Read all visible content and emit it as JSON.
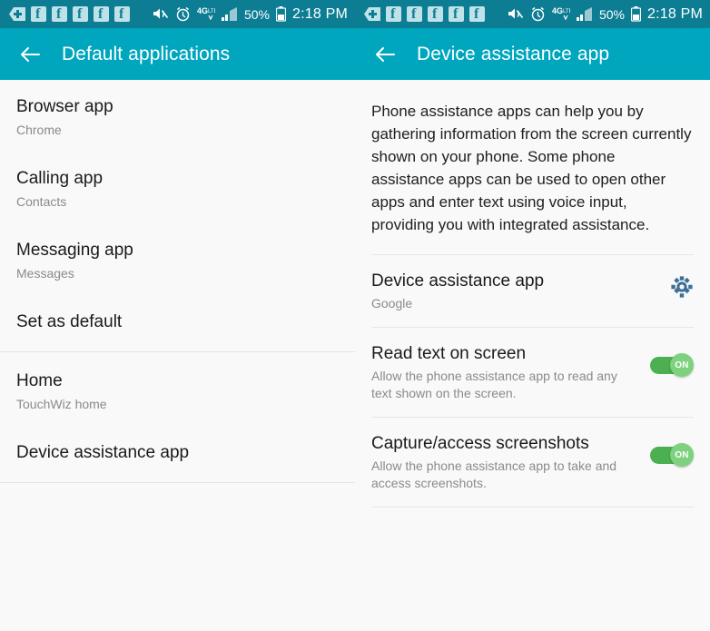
{
  "status_bar": {
    "notification_icons": [
      "more-notifications-icon",
      "facebook-icon",
      "facebook-icon",
      "facebook-icon",
      "facebook-icon",
      "facebook-icon"
    ],
    "mute_icon": "mute-icon",
    "alarm_icon": "alarm-icon",
    "network_label": "4G",
    "network_sub": "LTE",
    "signal_icon": "signal-bars-icon",
    "battery_percent": "50%",
    "battery_icon": "battery-icon",
    "time": "2:18 PM"
  },
  "left_panel": {
    "header": {
      "back_icon": "back-arrow-icon",
      "title": "Default applications"
    },
    "items": [
      {
        "title": "Browser app",
        "subtitle": "Chrome"
      },
      {
        "title": "Calling app",
        "subtitle": "Contacts"
      },
      {
        "title": "Messaging app",
        "subtitle": "Messages"
      },
      {
        "title": "Set as default",
        "subtitle": ""
      },
      {
        "title": "Home",
        "subtitle": "TouchWiz home"
      },
      {
        "title": "Device assistance app",
        "subtitle": ""
      }
    ]
  },
  "right_panel": {
    "header": {
      "back_icon": "back-arrow-icon",
      "title": "Device assistance app"
    },
    "description": "Phone assistance apps can help you by gathering information from the screen currently shown on your phone. Some phone assistance apps can be used to open other apps and enter text using voice input, providing you with integrated assistance.",
    "rows": [
      {
        "title": "Device assistance app",
        "subtitle": "Google",
        "control": "gear-icon"
      },
      {
        "title": "Read text on screen",
        "subtitle": "Allow the phone assistance app to read any text shown on the screen.",
        "control": "toggle",
        "toggle_state": "ON"
      },
      {
        "title": "Capture/access screenshots",
        "subtitle": "Allow the phone assistance app to take and access screenshots.",
        "control": "toggle",
        "toggle_state": "ON"
      }
    ]
  },
  "colors": {
    "status_bar": "#0D7D94",
    "header": "#00A6BE",
    "background": "#F9F9F9",
    "toggle_on_track": "#4CAF50",
    "toggle_on_thumb": "#7ED17F",
    "gear": "#3E7096"
  }
}
